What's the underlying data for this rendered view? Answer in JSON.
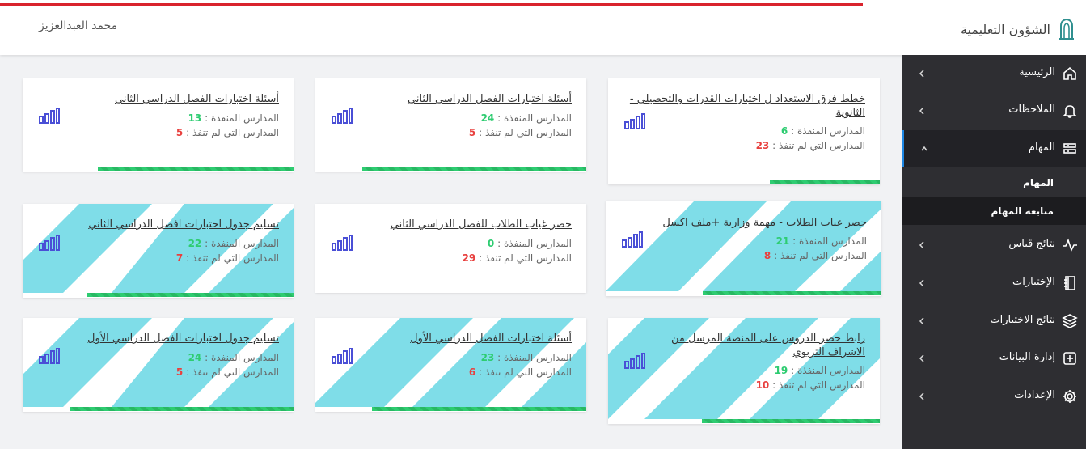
{
  "header": {
    "brand": "الشؤون التعليمية",
    "user_name": "محمد العبدالعزيز"
  },
  "sidebar": {
    "items": [
      {
        "label": "الرئيسية",
        "icon": "home-icon"
      },
      {
        "label": "الملاحظات",
        "icon": "bell-icon"
      },
      {
        "label": "المهام",
        "icon": "tasks-icon"
      },
      {
        "label": "نتائج قياس",
        "icon": "pulse-icon"
      },
      {
        "label": "الإختبارات",
        "icon": "book-icon"
      },
      {
        "label": "نتائج الاختبارات",
        "icon": "layers-icon"
      },
      {
        "label": "إدارة البيانات",
        "icon": "plus-square-icon"
      },
      {
        "label": "الإعدادات",
        "icon": "gear-icon"
      }
    ],
    "sub_items": [
      {
        "label": "المهام"
      },
      {
        "label": "متابعة المهام"
      }
    ]
  },
  "labels": {
    "executed": "المدارس المنفذة :",
    "not_executed": "المدارس التي لم تنفذ :"
  },
  "cards": [
    {
      "title": "خطط فرق الاستعداد ل اختبارات القدرات والتحصيلي - الثانوية",
      "executed": "6",
      "not_executed": "23"
    },
    {
      "title": "أسئلة اختبارات الفصل الدراسي الثاني",
      "executed": "24",
      "not_executed": "5"
    },
    {
      "title": "أسئلة اختبارات الفصل الدراسي الثاني",
      "executed": "13",
      "not_executed": "5"
    },
    {
      "title": "حصر غياب الطلاب - مهمة وزارية +ملف اكسل",
      "executed": "21",
      "not_executed": "8"
    },
    {
      "title": "حصر غياب الطلاب للفصل الدراسي الثاني",
      "executed": "0",
      "not_executed": "29"
    },
    {
      "title": "تسليم جدول اختبارات افصل الدراسي الثاني",
      "executed": "22",
      "not_executed": "7"
    },
    {
      "title": "رابط حصر الدروس على المنصة المرسل من الاشراف التربوي",
      "executed": "19",
      "not_executed": "10"
    },
    {
      "title": "أسئلة اختبارات الفصل الدراسي الأول",
      "executed": "23",
      "not_executed": "6"
    },
    {
      "title": "تسليم جدول اختبارات الفصل الدراسي الأول",
      "executed": "24",
      "not_executed": "5"
    }
  ],
  "colors": {
    "accent_red": "#d9232d",
    "sidebar_bg": "#2e2e32",
    "active_indicator": "#1e88e5",
    "stripe": "#7fdde8",
    "progress_green": "#2ecc71",
    "number_green": "#2ecc71",
    "number_red": "#e8403e",
    "chart_icon": "#4a4fd6"
  }
}
